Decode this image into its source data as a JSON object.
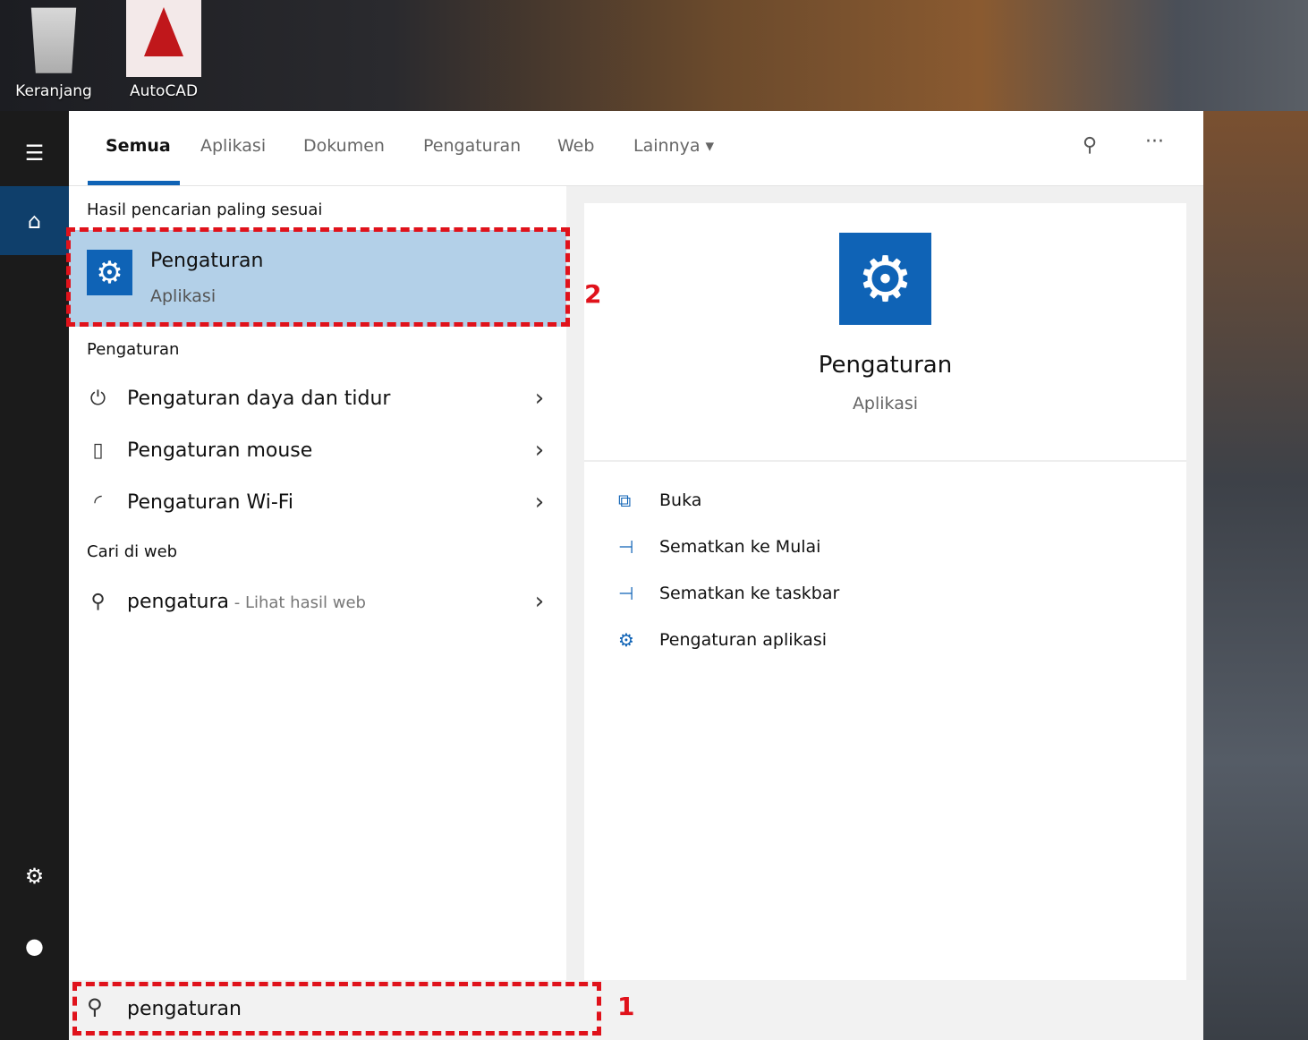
{
  "desktop": {
    "icons": [
      {
        "label": "Keranjang"
      },
      {
        "label": "AutoCAD"
      }
    ]
  },
  "tabs": [
    {
      "label": "Semua"
    },
    {
      "label": "Aplikasi"
    },
    {
      "label": "Dokumen"
    },
    {
      "label": "Pengaturan"
    },
    {
      "label": "Web"
    },
    {
      "label": "Lainnya"
    }
  ],
  "results": {
    "best_header": "Hasil pencarian paling sesuai",
    "best": {
      "title": "Pengaturan",
      "subtitle": "Aplikasi"
    },
    "settings_header": "Pengaturan",
    "settings_items": [
      {
        "label": "Pengaturan daya dan tidur",
        "icon": "power-icon"
      },
      {
        "label": "Pengaturan mouse",
        "icon": "mouse-icon"
      },
      {
        "label": "Pengaturan Wi-Fi",
        "icon": "wifi-icon"
      }
    ],
    "web_header": "Cari di web",
    "web_item": {
      "query": "pengatura",
      "suffix": " - Lihat hasil web"
    }
  },
  "preview": {
    "title": "Pengaturan",
    "subtitle": "Aplikasi",
    "actions": [
      {
        "label": "Buka",
        "icon": "open-icon"
      },
      {
        "label": "Sematkan ke Mulai",
        "icon": "pin-icon"
      },
      {
        "label": "Sematkan ke taskbar",
        "icon": "pin-icon"
      },
      {
        "label": "Pengaturan aplikasi",
        "icon": "gear-icon"
      }
    ]
  },
  "search": {
    "value": "pengaturan"
  },
  "annotations": {
    "one": "1",
    "two": "2"
  },
  "colors": {
    "accent": "#0f63b6",
    "highlight": "#b3d0e8",
    "annotation": "#e0121b"
  }
}
